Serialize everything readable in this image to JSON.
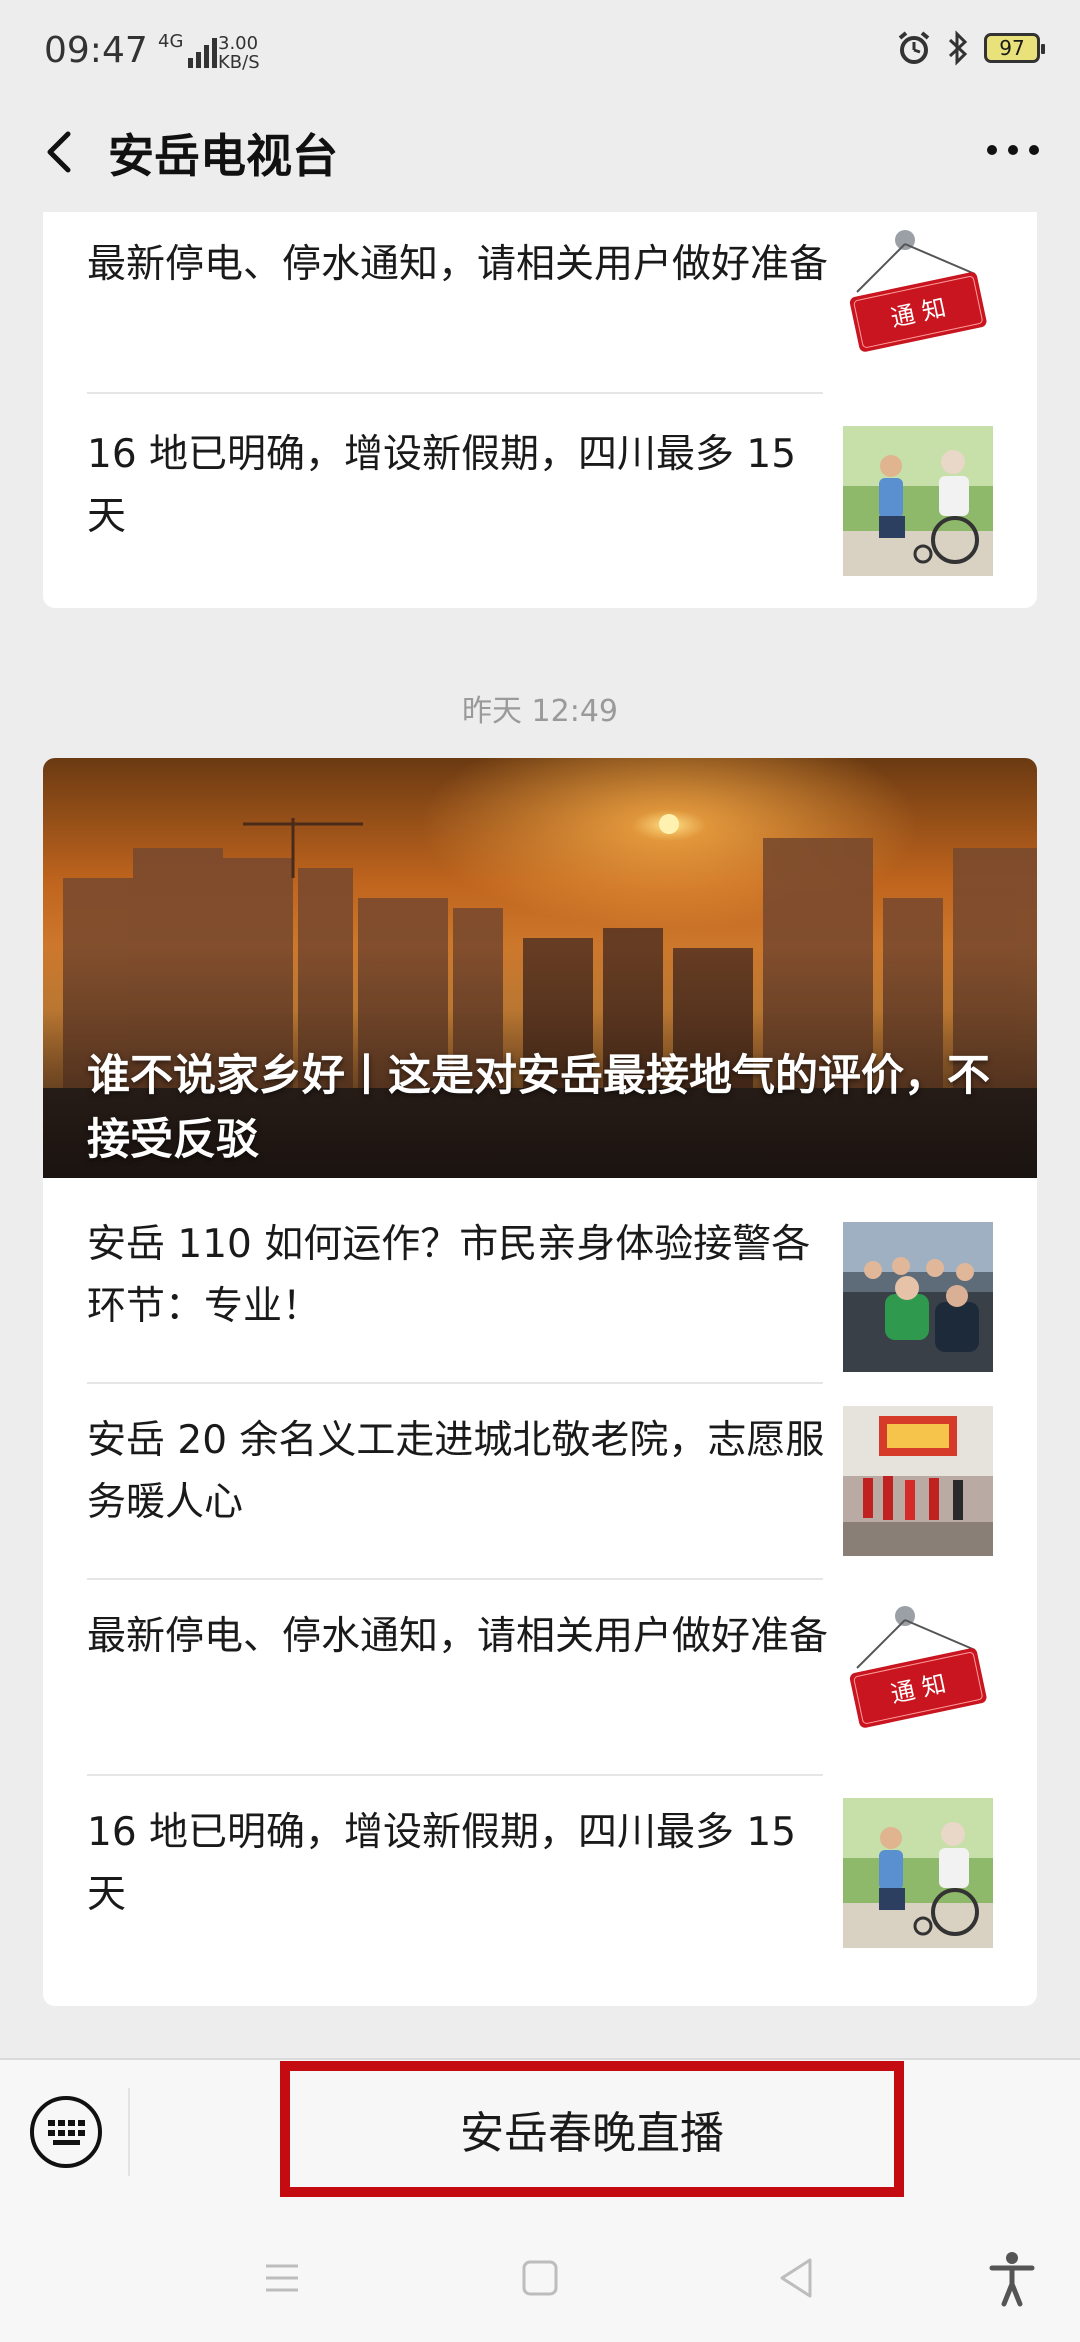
{
  "status_bar": {
    "time": "09:47",
    "network": "4G",
    "speed_value": "3.00",
    "speed_unit": "KB/S",
    "battery": "97"
  },
  "header": {
    "title": "安岳电视台"
  },
  "card1": {
    "items": [
      {
        "title": "最新停电、停水通知，请相关用户做好准备",
        "thumb": "notice-sign"
      },
      {
        "title": "16 地已明确，增设新假期，四川最多 15 天",
        "thumb": "wheelchair-photo"
      }
    ]
  },
  "timestamp": "昨天 12:49",
  "card2": {
    "hero_title": "谁不说家乡好丨这是对安岳最接地气的评价，不接受反驳",
    "items": [
      {
        "title": "安岳 110 如何运作？市民亲身体验接警各环节：专业！",
        "thumb": "police-office-photo"
      },
      {
        "title": "安岳 20 余名义工走进城北敬老院，志愿服务暖人心",
        "thumb": "volunteer-photo"
      },
      {
        "title": "最新停电、停水通知，请相关用户做好准备",
        "thumb": "notice-sign"
      },
      {
        "title": "16 地已明确，增设新假期，四川最多 15 天",
        "thumb": "wheelchair-photo"
      }
    ]
  },
  "bottom_bar": {
    "menu_label": "安岳春晚直播"
  },
  "colors": {
    "background": "#ededed",
    "highlight": "#c40b12",
    "notice_red": "#c8151f"
  }
}
